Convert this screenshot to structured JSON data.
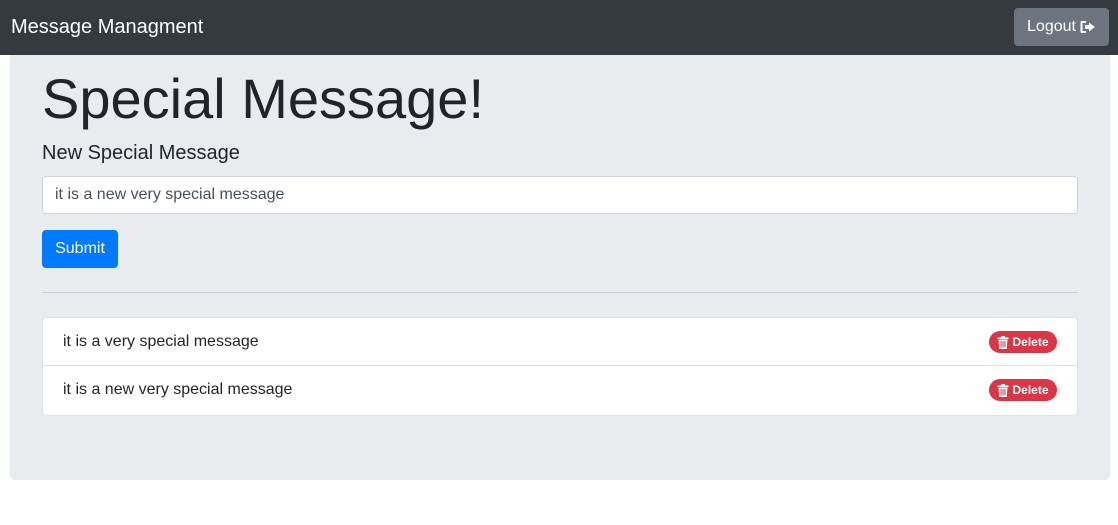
{
  "navbar": {
    "brand": "Message Managment",
    "logout_label": "Logout",
    "logout_icon": "sign-out-icon"
  },
  "main": {
    "title": "Special Message!",
    "form_label": "New Special Message",
    "input_value": "it is a new very special message",
    "submit_label": "Submit"
  },
  "messages": [
    {
      "text": "it is a very special message",
      "delete_label": "Delete",
      "icon": "trash-icon"
    },
    {
      "text": "it is a new very special message",
      "delete_label": "Delete",
      "icon": "trash-icon"
    }
  ],
  "colors": {
    "navbar": "#343a40",
    "logout": "#6c757d",
    "primary": "#007bff",
    "danger": "#dc3545",
    "jumbotron": "#e9ecef"
  }
}
